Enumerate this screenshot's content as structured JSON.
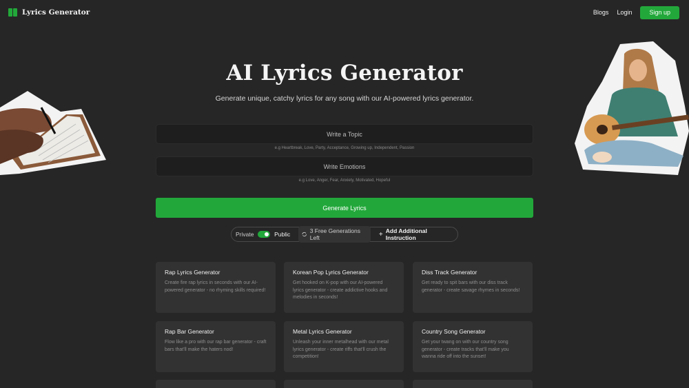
{
  "header": {
    "brand": "Lyrics Generator",
    "nav": [
      "Blogs",
      "Login"
    ],
    "signup_label": "Sign up"
  },
  "hero": {
    "title": "AI Lyrics Generator",
    "subtitle": "Generate unique, catchy lyrics for any song with our AI-powered lyrics generator."
  },
  "form": {
    "topic_placeholder": "Write a Topic",
    "topic_hint": "e.g Heartbreak, Love, Party, Acceptance, Growing up, Independent, Passion",
    "emotions_placeholder": "Write Emotions",
    "emotions_hint": "e.g Love, Anger, Fear, Anxiety, Motivated, Hopeful",
    "generate_label": "Generate Lyrics"
  },
  "options": {
    "private_label": "Private",
    "public_label": "Public",
    "generations_left": "3 Free Generations Left",
    "add_instruction": "Add Additional Instruction"
  },
  "cards": [
    {
      "title": "Rap Lyrics Generator",
      "desc": "Create fire rap lyrics in seconds with our AI-powered generator - no rhyming skills required!"
    },
    {
      "title": "Korean Pop Lyrics Generator",
      "desc": "Get hooked on K-pop with our AI-powered lyrics generator - create addictive hooks and melodies in seconds!"
    },
    {
      "title": "Diss Track Generator",
      "desc": "Get ready to spit bars with our diss track generator - create savage rhymes in seconds!"
    },
    {
      "title": "Rap Bar Generator",
      "desc": "Flow like a pro with our rap bar generator - craft bars that'll make the haters nod!"
    },
    {
      "title": "Metal Lyrics Generator",
      "desc": "Unleash your inner metalhead with our metal lyrics generator - create riffs that'll crush the competition!"
    },
    {
      "title": "Country Song Generator",
      "desc": "Get your twang on with our country song generator - create tracks that'll make you wanna ride off into the sunset!"
    }
  ],
  "colors": {
    "accent": "#22a83a",
    "background": "#262626",
    "card": "#323232"
  }
}
